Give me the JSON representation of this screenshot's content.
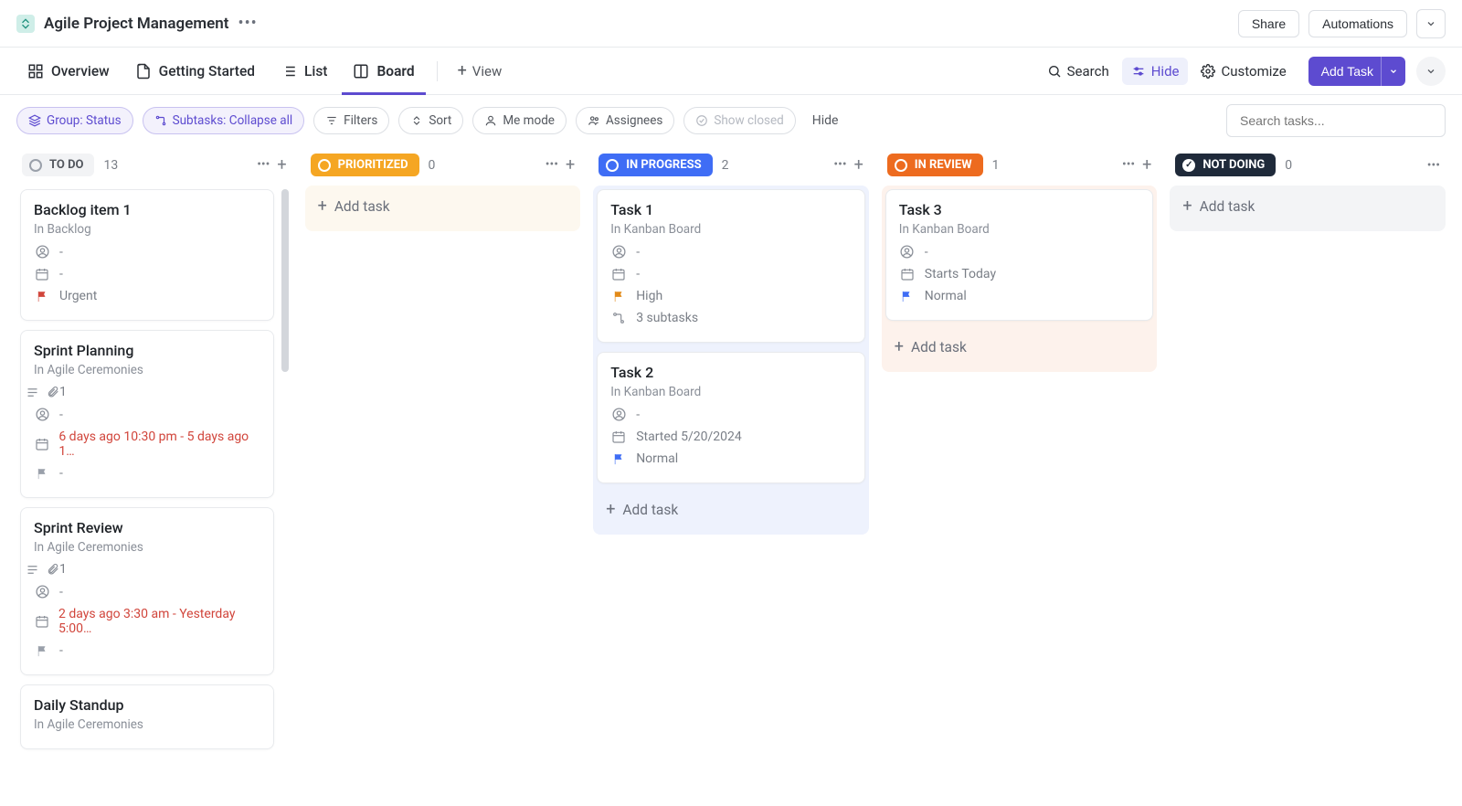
{
  "header": {
    "title": "Agile Project Management",
    "share": "Share",
    "automations": "Automations"
  },
  "views": {
    "overview": "Overview",
    "getting_started": "Getting Started",
    "list": "List",
    "board": "Board",
    "add_view": "View",
    "search": "Search",
    "hide": "Hide",
    "customize": "Customize",
    "add_task": "Add Task"
  },
  "filters": {
    "group": "Group: Status",
    "subtasks": "Subtasks: Collapse all",
    "filters": "Filters",
    "sort": "Sort",
    "me_mode": "Me mode",
    "assignees": "Assignees",
    "show_closed": "Show closed",
    "hide": "Hide",
    "search_placeholder": "Search tasks..."
  },
  "columns": [
    {
      "key": "todo",
      "label": "TO DO",
      "count": "13",
      "pill_class": "pill-todo",
      "body_class": "shaded-todo",
      "show_scrollbar": true,
      "add_task_below": false,
      "tasks": [
        {
          "title": "Backlog item 1",
          "location": "In Backlog",
          "rows": [
            {
              "icon": "assignee",
              "text": "-"
            },
            {
              "icon": "date",
              "text": "-"
            },
            {
              "icon": "flag",
              "flag_class": "flag-red",
              "text": "Urgent"
            }
          ]
        },
        {
          "title": "Sprint Planning",
          "location": "In Agile Ceremonies",
          "rows": [
            {
              "icon": "desc-attach",
              "text": "1"
            },
            {
              "icon": "assignee",
              "text": "-"
            },
            {
              "icon": "date",
              "text": "6 days ago 10:30 pm - 5 days ago 1…",
              "red": true
            },
            {
              "icon": "flag",
              "flag_class": "flag-gray",
              "text": "-"
            }
          ]
        },
        {
          "title": "Sprint Review",
          "location": "In Agile Ceremonies",
          "rows": [
            {
              "icon": "desc-attach",
              "text": "1"
            },
            {
              "icon": "assignee",
              "text": "-"
            },
            {
              "icon": "date",
              "text": "2 days ago 3:30 am - Yesterday 5:00…",
              "red": true
            },
            {
              "icon": "flag",
              "flag_class": "flag-gray",
              "text": "-"
            }
          ]
        },
        {
          "title": "Daily Standup",
          "location": "In Agile Ceremonies",
          "rows": []
        }
      ]
    },
    {
      "key": "prioritized",
      "label": "PRIORITIZED",
      "count": "0",
      "pill_class": "pill-prioritized",
      "body_class": "shaded-yellow",
      "add_task_below": true,
      "tasks": []
    },
    {
      "key": "inprogress",
      "label": "IN PROGRESS",
      "count": "2",
      "pill_class": "pill-progress",
      "body_class": "shaded-blue",
      "add_task_below": true,
      "tasks": [
        {
          "title": "Task 1",
          "location": "In Kanban Board",
          "rows": [
            {
              "icon": "assignee",
              "text": "-"
            },
            {
              "icon": "date",
              "text": "-"
            },
            {
              "icon": "flag",
              "flag_class": "flag-orange",
              "text": "High"
            },
            {
              "icon": "subtasks",
              "text": "3 subtasks"
            }
          ]
        },
        {
          "title": "Task 2",
          "location": "In Kanban Board",
          "rows": [
            {
              "icon": "assignee",
              "text": "-"
            },
            {
              "icon": "date",
              "text": "Started 5/20/2024"
            },
            {
              "icon": "flag",
              "flag_class": "flag-blue",
              "text": "Normal"
            }
          ]
        }
      ]
    },
    {
      "key": "inreview",
      "label": "IN REVIEW",
      "count": "1",
      "pill_class": "pill-review",
      "body_class": "shaded-orange",
      "add_task_below": true,
      "tasks": [
        {
          "title": "Task 3",
          "location": "In Kanban Board",
          "rows": [
            {
              "icon": "assignee",
              "text": "-"
            },
            {
              "icon": "date",
              "text": "Starts Today"
            },
            {
              "icon": "flag",
              "flag_class": "flag-blue",
              "text": "Normal"
            }
          ]
        }
      ]
    },
    {
      "key": "notdoing",
      "label": "NOT DOING",
      "count": "0",
      "pill_class": "pill-notdoing",
      "body_class": "shaded-gray",
      "add_task_below": true,
      "only_more": true,
      "check_icon": true,
      "tasks": []
    }
  ],
  "add_task_label": "Add task"
}
